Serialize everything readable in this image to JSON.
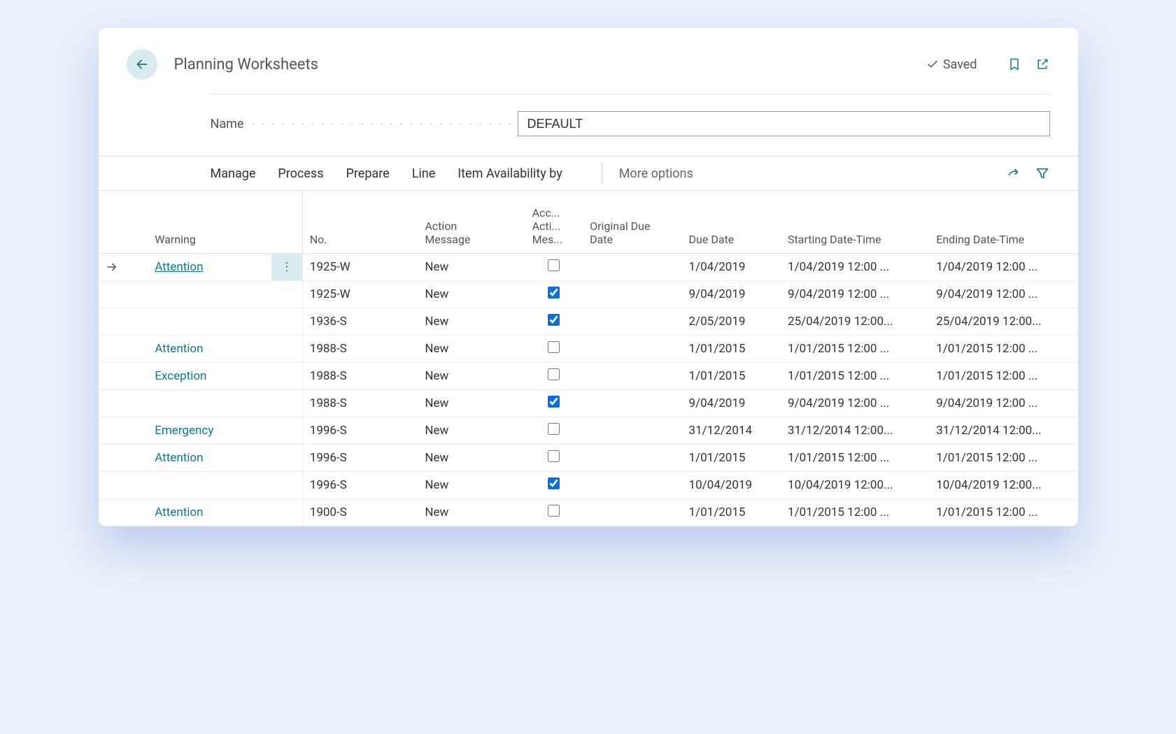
{
  "header": {
    "title": "Planning Worksheets",
    "saved_label": "Saved"
  },
  "name_field": {
    "label": "Name",
    "value": "DEFAULT"
  },
  "toolbar": {
    "manage": "Manage",
    "process": "Process",
    "prepare": "Prepare",
    "line": "Line",
    "item_avail": "Item Availability by",
    "more": "More options"
  },
  "columns": {
    "warning": "Warning",
    "no": "No.",
    "action_message": "Action Message",
    "accept": "Acc... Acti... Mes...",
    "original_due": "Original Due Date",
    "due_date": "Due Date",
    "start": "Starting Date-Time",
    "end": "Ending Date-Time"
  },
  "rows": [
    {
      "selected": true,
      "warning": "Attention",
      "no": "1925-W",
      "action": "New",
      "accept": false,
      "orig": "",
      "due": "1/04/2019",
      "start": "1/04/2019 12:00 ...",
      "end": "1/04/2019 12:00 ..."
    },
    {
      "selected": false,
      "warning": "",
      "no": "1925-W",
      "action": "New",
      "accept": true,
      "orig": "",
      "due": "9/04/2019",
      "start": "9/04/2019 12:00 ...",
      "end": "9/04/2019 12:00 ..."
    },
    {
      "selected": false,
      "warning": "",
      "no": "1936-S",
      "action": "New",
      "accept": true,
      "orig": "",
      "due": "2/05/2019",
      "start": "25/04/2019 12:00...",
      "end": "25/04/2019 12:00..."
    },
    {
      "selected": false,
      "warning": "Attention",
      "no": "1988-S",
      "action": "New",
      "accept": false,
      "orig": "",
      "due": "1/01/2015",
      "start": "1/01/2015 12:00 ...",
      "end": "1/01/2015 12:00 ..."
    },
    {
      "selected": false,
      "warning": "Exception",
      "no": "1988-S",
      "action": "New",
      "accept": false,
      "orig": "",
      "due": "1/01/2015",
      "start": "1/01/2015 12:00 ...",
      "end": "1/01/2015 12:00 ..."
    },
    {
      "selected": false,
      "warning": "",
      "no": "1988-S",
      "action": "New",
      "accept": true,
      "orig": "",
      "due": "9/04/2019",
      "start": "9/04/2019 12:00 ...",
      "end": "9/04/2019 12:00 ..."
    },
    {
      "selected": false,
      "warning": "Emergency",
      "no": "1996-S",
      "action": "New",
      "accept": false,
      "orig": "",
      "due": "31/12/2014",
      "start": "31/12/2014 12:00...",
      "end": "31/12/2014 12:00..."
    },
    {
      "selected": false,
      "warning": "Attention",
      "no": "1996-S",
      "action": "New",
      "accept": false,
      "orig": "",
      "due": "1/01/2015",
      "start": "1/01/2015 12:00 ...",
      "end": "1/01/2015 12:00 ..."
    },
    {
      "selected": false,
      "warning": "",
      "no": "1996-S",
      "action": "New",
      "accept": true,
      "orig": "",
      "due": "10/04/2019",
      "start": "10/04/2019 12:00...",
      "end": "10/04/2019 12:00..."
    },
    {
      "selected": false,
      "warning": "Attention",
      "no": "1900-S",
      "action": "New",
      "accept": false,
      "orig": "",
      "due": "1/01/2015",
      "start": "1/01/2015 12:00 ...",
      "end": "1/01/2015 12:00 ..."
    }
  ]
}
